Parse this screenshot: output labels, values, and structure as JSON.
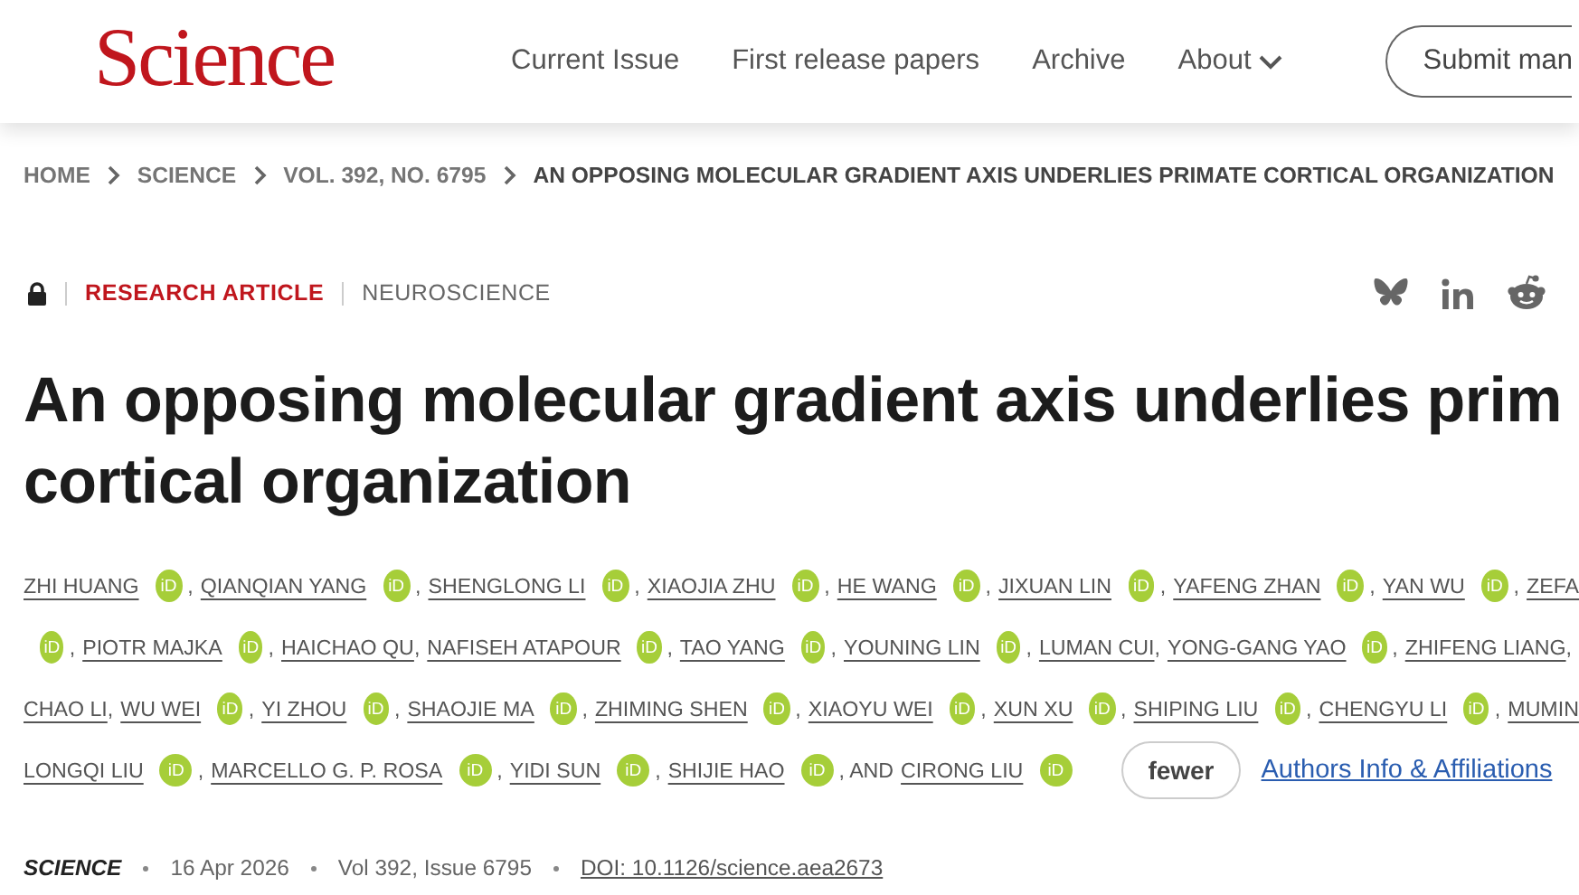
{
  "header": {
    "logo": "Science",
    "nav": [
      {
        "label": "Current Issue",
        "kind": "link"
      },
      {
        "label": "First release papers",
        "kind": "link"
      },
      {
        "label": "Archive",
        "kind": "link"
      },
      {
        "label": "About",
        "kind": "menu"
      }
    ],
    "submit": "Submit man"
  },
  "breadcrumb": [
    {
      "label": "HOME",
      "current": false
    },
    {
      "label": "SCIENCE",
      "current": false
    },
    {
      "label": "VOL. 392, NO. 6795",
      "current": false
    },
    {
      "label": "AN OPPOSING MOLECULAR GRADIENT AXIS UNDERLIES PRIMATE CORTICAL ORGANIZATION",
      "current": true
    }
  ],
  "article": {
    "locked": true,
    "type": "RESEARCH ARTICLE",
    "section": "NEUROSCIENCE",
    "title_lines": [
      "An opposing molecular gradient axis underlies prim",
      "cortical organization"
    ],
    "author_lines": [
      {
        "items": [
          {
            "kind": "author",
            "text": "ZHI HUANG"
          },
          {
            "kind": "orcid",
            "text": "iD"
          },
          {
            "kind": "sep",
            "text": ","
          },
          {
            "kind": "author",
            "text": "QIANQIAN YANG"
          },
          {
            "kind": "orcid",
            "text": "iD"
          },
          {
            "kind": "sep",
            "text": ","
          },
          {
            "kind": "author",
            "text": "SHENGLONG LI"
          },
          {
            "kind": "orcid",
            "text": "iD"
          },
          {
            "kind": "sep",
            "text": ","
          },
          {
            "kind": "author",
            "text": "XIAOJIA ZHU"
          },
          {
            "kind": "orcid",
            "text": "iD"
          },
          {
            "kind": "sep",
            "text": ","
          },
          {
            "kind": "author",
            "text": "HE WANG"
          },
          {
            "kind": "orcid",
            "text": "iD"
          },
          {
            "kind": "sep",
            "text": ","
          },
          {
            "kind": "author",
            "text": "JIXUAN LIN"
          },
          {
            "kind": "orcid",
            "text": "iD"
          },
          {
            "kind": "sep",
            "text": ","
          },
          {
            "kind": "author",
            "text": "YAFENG ZHAN"
          },
          {
            "kind": "orcid",
            "text": "iD"
          },
          {
            "kind": "sep",
            "text": ","
          },
          {
            "kind": "author",
            "text": "YAN WU"
          },
          {
            "kind": "orcid",
            "text": "iD"
          },
          {
            "kind": "sep",
            "text": ","
          },
          {
            "kind": "author",
            "text": "ZEFA"
          }
        ]
      },
      {
        "items": [
          {
            "kind": "orcid",
            "text": "iD"
          },
          {
            "kind": "sep",
            "text": ","
          },
          {
            "kind": "author",
            "text": "PIOTR MAJKA"
          },
          {
            "kind": "orcid",
            "text": "iD"
          },
          {
            "kind": "sep",
            "text": ","
          },
          {
            "kind": "author",
            "text": "HAICHAO QU"
          },
          {
            "kind": "sep",
            "text": ","
          },
          {
            "kind": "author",
            "text": "NAFISEH ATAPOUR"
          },
          {
            "kind": "orcid",
            "text": "iD"
          },
          {
            "kind": "sep",
            "text": ","
          },
          {
            "kind": "author",
            "text": "TAO YANG"
          },
          {
            "kind": "orcid",
            "text": "iD"
          },
          {
            "kind": "sep",
            "text": ","
          },
          {
            "kind": "author",
            "text": "YOUNING LIN"
          },
          {
            "kind": "orcid",
            "text": "iD"
          },
          {
            "kind": "sep",
            "text": ","
          },
          {
            "kind": "author",
            "text": "LUMAN CUI"
          },
          {
            "kind": "sep",
            "text": ","
          },
          {
            "kind": "author",
            "text": "YONG-GANG YAO"
          },
          {
            "kind": "orcid",
            "text": "iD"
          },
          {
            "kind": "sep",
            "text": ","
          },
          {
            "kind": "author",
            "text": "ZHIFENG LIANG"
          },
          {
            "kind": "sep",
            "text": ","
          }
        ]
      },
      {
        "items": [
          {
            "kind": "author",
            "text": "CHAO LI"
          },
          {
            "kind": "sep",
            "text": ","
          },
          {
            "kind": "author",
            "text": "WU WEI"
          },
          {
            "kind": "orcid",
            "text": "iD"
          },
          {
            "kind": "sep",
            "text": ","
          },
          {
            "kind": "author",
            "text": "YI ZHOU"
          },
          {
            "kind": "orcid",
            "text": "iD"
          },
          {
            "kind": "sep",
            "text": ","
          },
          {
            "kind": "author",
            "text": "SHAOJIE MA"
          },
          {
            "kind": "orcid",
            "text": "iD"
          },
          {
            "kind": "sep",
            "text": ","
          },
          {
            "kind": "author",
            "text": "ZHIMING SHEN"
          },
          {
            "kind": "orcid",
            "text": "iD"
          },
          {
            "kind": "sep",
            "text": ","
          },
          {
            "kind": "author",
            "text": "XIAOYU WEI"
          },
          {
            "kind": "orcid",
            "text": "iD"
          },
          {
            "kind": "sep",
            "text": ","
          },
          {
            "kind": "author",
            "text": "XUN XU"
          },
          {
            "kind": "orcid",
            "text": "iD"
          },
          {
            "kind": "sep",
            "text": ","
          },
          {
            "kind": "author",
            "text": "SHIPING LIU"
          },
          {
            "kind": "orcid",
            "text": "iD"
          },
          {
            "kind": "sep",
            "text": ","
          },
          {
            "kind": "author",
            "text": "CHENGYU LI"
          },
          {
            "kind": "orcid",
            "text": "iD"
          },
          {
            "kind": "sep",
            "text": ","
          },
          {
            "kind": "author",
            "text": "MUMIN"
          }
        ]
      },
      {
        "items": [
          {
            "kind": "author",
            "text": "LONGQI LIU"
          },
          {
            "kind": "orcid",
            "text": "iD"
          },
          {
            "kind": "sep",
            "text": ","
          },
          {
            "kind": "author",
            "text": "MARCELLO G. P. ROSA"
          },
          {
            "kind": "orcid",
            "text": "iD"
          },
          {
            "kind": "sep",
            "text": ","
          },
          {
            "kind": "author",
            "text": "YIDI SUN"
          },
          {
            "kind": "orcid",
            "text": "iD"
          },
          {
            "kind": "sep",
            "text": ","
          },
          {
            "kind": "author",
            "text": "SHIJIE HAO"
          },
          {
            "kind": "orcid",
            "text": "iD"
          },
          {
            "kind": "sep",
            "text": ", AND"
          },
          {
            "kind": "author",
            "text": "CIRONG LIU"
          },
          {
            "kind": "orcid",
            "text": "iD"
          },
          {
            "kind": "fewer",
            "text": "fewer"
          },
          {
            "kind": "link",
            "text": "Authors Info & Affiliations"
          }
        ]
      }
    ],
    "meta": {
      "journal": "SCIENCE",
      "date": "16 Apr 2026",
      "issue": "Vol 392, Issue 6795",
      "doi": "DOI: 10.1126/science.aea2673"
    }
  }
}
